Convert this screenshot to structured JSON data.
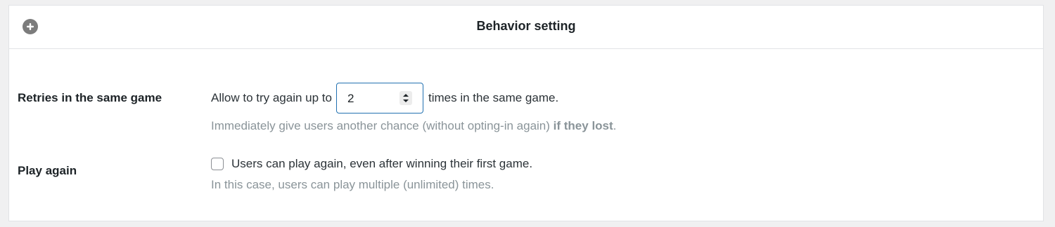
{
  "panel": {
    "title": "Behavior setting",
    "toggle_icon": "plus-circle-icon"
  },
  "retries": {
    "label": "Retries in the same game",
    "prefix": "Allow to try again up to",
    "value": "2",
    "suffix": "times in the same game.",
    "hint_text": "Immediately give users another chance (without opting-in again) ",
    "hint_bold": "if they lost",
    "hint_end": "."
  },
  "play_again": {
    "label": "Play again",
    "checked": false,
    "checkbox_label": "Users can play again, even after winning their first game.",
    "hint": "In this case, users can play multiple (unlimited) times."
  },
  "colors": {
    "accent": "#2271b1",
    "hint": "#8a9499",
    "toggle": "#7c7c7c"
  }
}
